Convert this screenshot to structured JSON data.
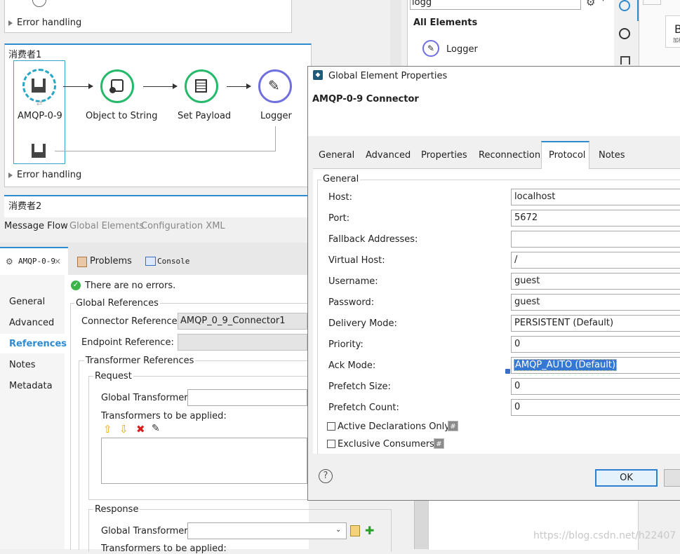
{
  "flow1": {
    "error_handling": "Error handling",
    "title": "消费者1",
    "nodes": [
      "AMQP-0-9",
      "Object to String",
      "Set Payload",
      "Logger"
    ],
    "error_handling2": "Error handling"
  },
  "flow2": {
    "title": "消费者2"
  },
  "editor_tabs": [
    "Message Flow",
    "Global Elements",
    "Configuration XML"
  ],
  "view_tabs": {
    "amqp": "AMQP-0-9",
    "problems": "Problems",
    "console": "Console"
  },
  "props": {
    "nav": [
      "General",
      "Advanced",
      "References",
      "Notes",
      "Metadata"
    ],
    "no_errors": "There are no errors.",
    "global_references": "Global References",
    "connector_reference_label": "Connector Reference:",
    "connector_reference_value": "AMQP_0_9_Connector1",
    "endpoint_reference_label": "Endpoint Reference:",
    "transformer_references": "Transformer References",
    "request": "Request",
    "global_transformers": "Global Transformers:",
    "transformers_applied": "Transformers to be applied:",
    "response": "Response",
    "global_transformers2": "Global Transformers:",
    "transformers_applied2": "Transformers to be applied:"
  },
  "palette": {
    "search_value": "logg",
    "all_elements": "All Elements",
    "logger": "Logger"
  },
  "right_edge": {
    "b": "B",
    "small": "加标"
  },
  "dialog": {
    "window_title": "Global Element Properties",
    "heading": "AMQP-0-9 Connector",
    "tabs": [
      "General",
      "Advanced",
      "Properties",
      "Reconnection",
      "Protocol",
      "Notes"
    ],
    "active_tab": "Protocol",
    "group_label": "General",
    "fields": [
      {
        "label": "Host:",
        "value": "localhost"
      },
      {
        "label": "Port:",
        "value": "5672"
      },
      {
        "label": "Fallback Addresses:",
        "value": ""
      },
      {
        "label": "Virtual Host:",
        "value": "/"
      },
      {
        "label": "Username:",
        "value": "guest"
      },
      {
        "label": "Password:",
        "value": "guest"
      },
      {
        "label": "Delivery Mode:",
        "value": "PERSISTENT (Default)"
      },
      {
        "label": "Priority:",
        "value": "0"
      },
      {
        "label": "Ack Mode:",
        "value": "AMQP_AUTO (Default)"
      },
      {
        "label": "Prefetch Size:",
        "value": "0"
      },
      {
        "label": "Prefetch Count:",
        "value": "0"
      }
    ],
    "checkbox_active": "Active Declarations Only",
    "checkbox_exclusive": "Exclusive Consumers",
    "ok_label": "OK"
  },
  "watermark": "https://blog.csdn.net/h22407"
}
